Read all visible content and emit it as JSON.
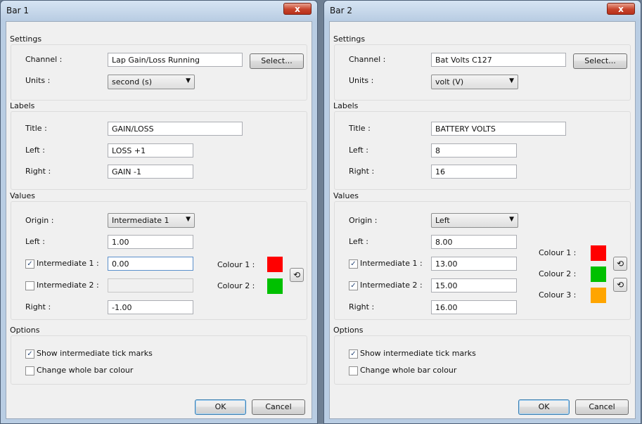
{
  "bar1": {
    "title": "Bar 1",
    "close_label": "x",
    "settings": {
      "group_label": "Settings",
      "channel_label": "Channel :",
      "channel_value": "Lap Gain/Loss Running",
      "select_label": "Select...",
      "units_label": "Units :",
      "units_value": "second (s)"
    },
    "labels": {
      "group_label": "Labels",
      "title_label": "Title :",
      "title_value": "GAIN/LOSS",
      "left_label": "Left :",
      "left_value": "LOSS +1",
      "right_label": "Right :",
      "right_value": "GAIN -1"
    },
    "values": {
      "group_label": "Values",
      "origin_label": "Origin :",
      "origin_value": "Intermediate 1",
      "left_label": "Left :",
      "left_value": "1.00",
      "int1_label": "Intermediate 1 :",
      "int1_checked": true,
      "int1_value": "0.00",
      "int2_label": "Intermediate 2 :",
      "int2_checked": false,
      "int2_value": "",
      "right_label": "Right :",
      "right_value": "-1.00",
      "colour1_label": "Colour 1 :",
      "colour2_label": "Colour 2 :",
      "colour1": "#ff0000",
      "colour2": "#00c000"
    },
    "options": {
      "group_label": "Options",
      "tick_marks_label": "Show intermediate tick marks",
      "tick_marks_checked": true,
      "whole_bar_label": "Change whole bar colour",
      "whole_bar_checked": false
    },
    "ok_label": "OK",
    "cancel_label": "Cancel"
  },
  "bar2": {
    "title": "Bar 2",
    "close_label": "x",
    "settings": {
      "group_label": "Settings",
      "channel_label": "Channel :",
      "channel_value": "Bat Volts C127",
      "select_label": "Select...",
      "units_label": "Units :",
      "units_value": "volt (V)"
    },
    "labels": {
      "group_label": "Labels",
      "title_label": "Title :",
      "title_value": "BATTERY VOLTS",
      "left_label": "Left :",
      "left_value": "8",
      "right_label": "Right :",
      "right_value": "16"
    },
    "values": {
      "group_label": "Values",
      "origin_label": "Origin :",
      "origin_value": "Left",
      "left_label": "Left :",
      "left_value": "8.00",
      "int1_label": "Intermediate 1 :",
      "int1_checked": true,
      "int1_value": "13.00",
      "int2_label": "Intermediate 2 :",
      "int2_checked": true,
      "int2_value": "15.00",
      "right_label": "Right :",
      "right_value": "16.00",
      "colour1_label": "Colour 1 :",
      "colour2_label": "Colour 2 :",
      "colour3_label": "Colour 3 :",
      "colour1": "#ff0000",
      "colour2": "#00c000",
      "colour3": "#ffa500"
    },
    "options": {
      "group_label": "Options",
      "tick_marks_label": "Show intermediate tick marks",
      "tick_marks_checked": true,
      "whole_bar_label": "Change whole bar colour",
      "whole_bar_checked": false
    },
    "ok_label": "OK",
    "cancel_label": "Cancel"
  },
  "icons": {
    "checkmark": "✓",
    "dropdown_arrow": "▼",
    "swap_arrow": "⟲"
  }
}
